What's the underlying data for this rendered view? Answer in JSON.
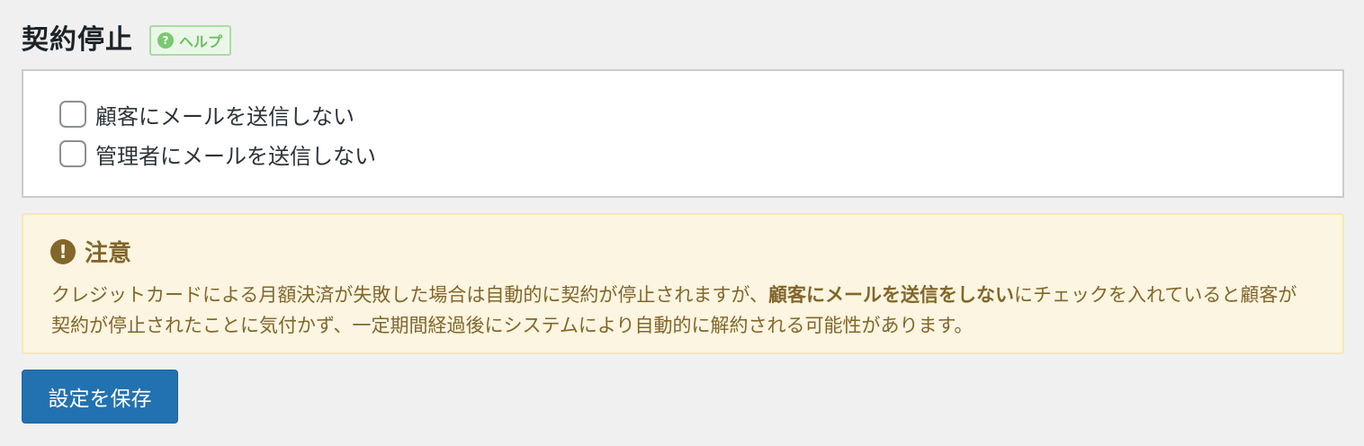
{
  "section": {
    "title": "契約停止",
    "help_label": "ヘルプ",
    "help_icon": "question-circle-icon"
  },
  "options": [
    {
      "label": "顧客にメールを送信しない",
      "checked": false
    },
    {
      "label": "管理者にメールを送信しない",
      "checked": false
    }
  ],
  "notice": {
    "icon": "exclamation-circle-icon",
    "title": "注意",
    "text_before": "クレジットカードによる月額決済が失敗した場合は自動的に契約が停止されますが、",
    "text_bold": "顧客にメールを送信をしない",
    "text_after": "にチェックを入れていると顧客が契約が停止されたことに気付かず、一定期間経過後にシステムにより自動的に解約される可能性があります。"
  },
  "actions": {
    "save_label": "設定を保存"
  },
  "colors": {
    "primary": "#2271b1",
    "help_green": "#6cc063",
    "notice_bg": "#fcf5e1",
    "notice_text": "#82662a"
  }
}
